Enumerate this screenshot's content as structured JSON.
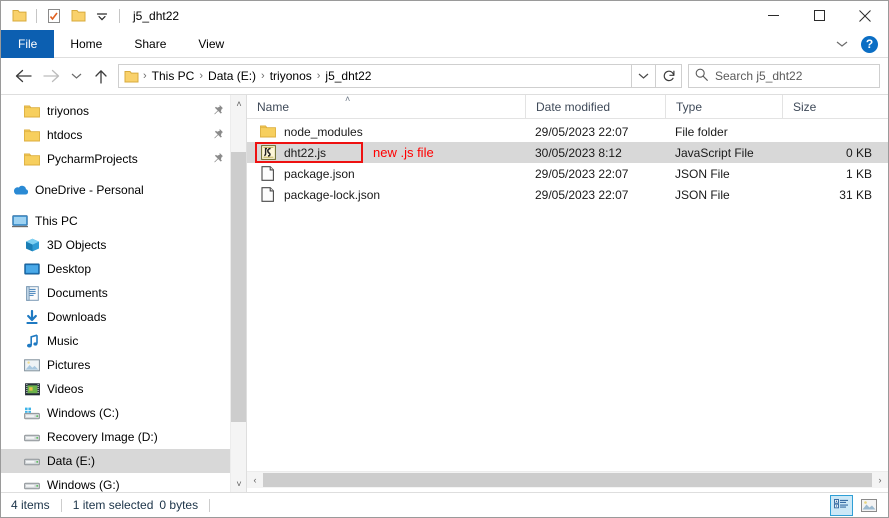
{
  "window": {
    "title": "j5_dht22",
    "quick_access": [
      {
        "name": "folder-icon",
        "label": "Folder"
      },
      {
        "name": "properties-icon",
        "label": "Properties"
      },
      {
        "name": "new-folder-icon",
        "label": "New folder"
      },
      {
        "name": "customize-dropdown-icon",
        "label": "Customize Quick Access Toolbar"
      }
    ],
    "caption_buttons": [
      {
        "name": "minimize-button",
        "label": "Minimize"
      },
      {
        "name": "maximize-button",
        "label": "Maximize"
      },
      {
        "name": "close-button",
        "label": "Close"
      }
    ]
  },
  "ribbon": {
    "tabs": [
      {
        "label": "File",
        "active": true
      },
      {
        "label": "Home",
        "active": false
      },
      {
        "label": "Share",
        "active": false
      },
      {
        "label": "View",
        "active": false
      }
    ],
    "expand_label": "˅",
    "help_label": "?"
  },
  "navigation": {
    "back_label": "←",
    "forward_label": "→",
    "recent_label": "˅",
    "up_label": "↑",
    "breadcrumb": [
      "This PC",
      "Data (E:)",
      "triyonos",
      "j5_dht22"
    ],
    "breadcrumb_sep": "›",
    "address_dropdown_label": "˅",
    "refresh_label": "↻"
  },
  "search": {
    "placeholder": "Search j5_dht22",
    "icon": "search-icon"
  },
  "sidebar": {
    "items": [
      {
        "label": "triyonos",
        "icon": "folder-icon",
        "indent": 1,
        "pinned": true,
        "selected": false
      },
      {
        "label": "htdocs",
        "icon": "folder-icon",
        "indent": 1,
        "pinned": true,
        "selected": false
      },
      {
        "label": "PycharmProjects",
        "icon": "folder-icon",
        "indent": 1,
        "pinned": true,
        "selected": false
      },
      {
        "label": "OneDrive - Personal",
        "icon": "onedrive-icon",
        "indent": 0,
        "pinned": false,
        "selected": false,
        "gap_before": true
      },
      {
        "label": "This PC",
        "icon": "this-pc-icon",
        "indent": 0,
        "pinned": false,
        "selected": false,
        "gap_before": true
      },
      {
        "label": "3D Objects",
        "icon": "3d-objects-icon",
        "indent": 1,
        "pinned": false,
        "selected": false
      },
      {
        "label": "Desktop",
        "icon": "desktop-icon",
        "indent": 1,
        "pinned": false,
        "selected": false
      },
      {
        "label": "Documents",
        "icon": "documents-icon",
        "indent": 1,
        "pinned": false,
        "selected": false
      },
      {
        "label": "Downloads",
        "icon": "downloads-icon",
        "indent": 1,
        "pinned": false,
        "selected": false
      },
      {
        "label": "Music",
        "icon": "music-icon",
        "indent": 1,
        "pinned": false,
        "selected": false
      },
      {
        "label": "Pictures",
        "icon": "pictures-icon",
        "indent": 1,
        "pinned": false,
        "selected": false
      },
      {
        "label": "Videos",
        "icon": "videos-icon",
        "indent": 1,
        "pinned": false,
        "selected": false
      },
      {
        "label": "Windows (C:)",
        "icon": "system-drive-icon",
        "indent": 1,
        "pinned": false,
        "selected": false
      },
      {
        "label": "Recovery Image (D:)",
        "icon": "drive-icon",
        "indent": 1,
        "pinned": false,
        "selected": false
      },
      {
        "label": "Data (E:)",
        "icon": "drive-icon",
        "indent": 1,
        "pinned": false,
        "selected": true
      },
      {
        "label": "Windows (G:)",
        "icon": "drive-icon",
        "indent": 1,
        "pinned": false,
        "selected": false
      }
    ],
    "pin_glyph": "📌",
    "scroll_up": "˄",
    "scroll_down": "˅"
  },
  "file_list": {
    "columns": [
      {
        "label": "Name",
        "sorted": "asc"
      },
      {
        "label": "Date modified",
        "sorted": null
      },
      {
        "label": "Type",
        "sorted": null
      },
      {
        "label": "Size",
        "sorted": null
      }
    ],
    "sort_caret": "˄",
    "rows": [
      {
        "name": "node_modules",
        "date": "29/05/2023 22:07",
        "type": "File folder",
        "size": "",
        "icon": "folder-icon",
        "selected": false
      },
      {
        "name": "dht22.js",
        "date": "30/05/2023 8:12",
        "type": "JavaScript File",
        "size": "0 KB",
        "icon": "javascript-file-icon",
        "selected": true
      },
      {
        "name": "package.json",
        "date": "29/05/2023 22:07",
        "type": "JSON File",
        "size": "1 KB",
        "icon": "json-file-icon",
        "selected": false
      },
      {
        "name": "package-lock.json",
        "date": "29/05/2023 22:07",
        "type": "JSON File",
        "size": "31 KB",
        "icon": "json-file-icon",
        "selected": false
      }
    ],
    "h_scroll_left": "‹",
    "h_scroll_right": "›"
  },
  "annotation": {
    "text": "new .js file",
    "color": "#ff0000"
  },
  "statusbar": {
    "item_count": "4 items",
    "selection": "1 item selected",
    "selection_size": "0 bytes",
    "view_buttons": [
      {
        "name": "details-view-button",
        "label": "Details view",
        "active": true
      },
      {
        "name": "large-icons-view-button",
        "label": "Large icons view",
        "active": false
      }
    ]
  },
  "colors": {
    "accent": "#0c5fb1",
    "selection": "#d8d8d8",
    "annotation": "#ff0000",
    "folder": "#f7cf5e"
  }
}
